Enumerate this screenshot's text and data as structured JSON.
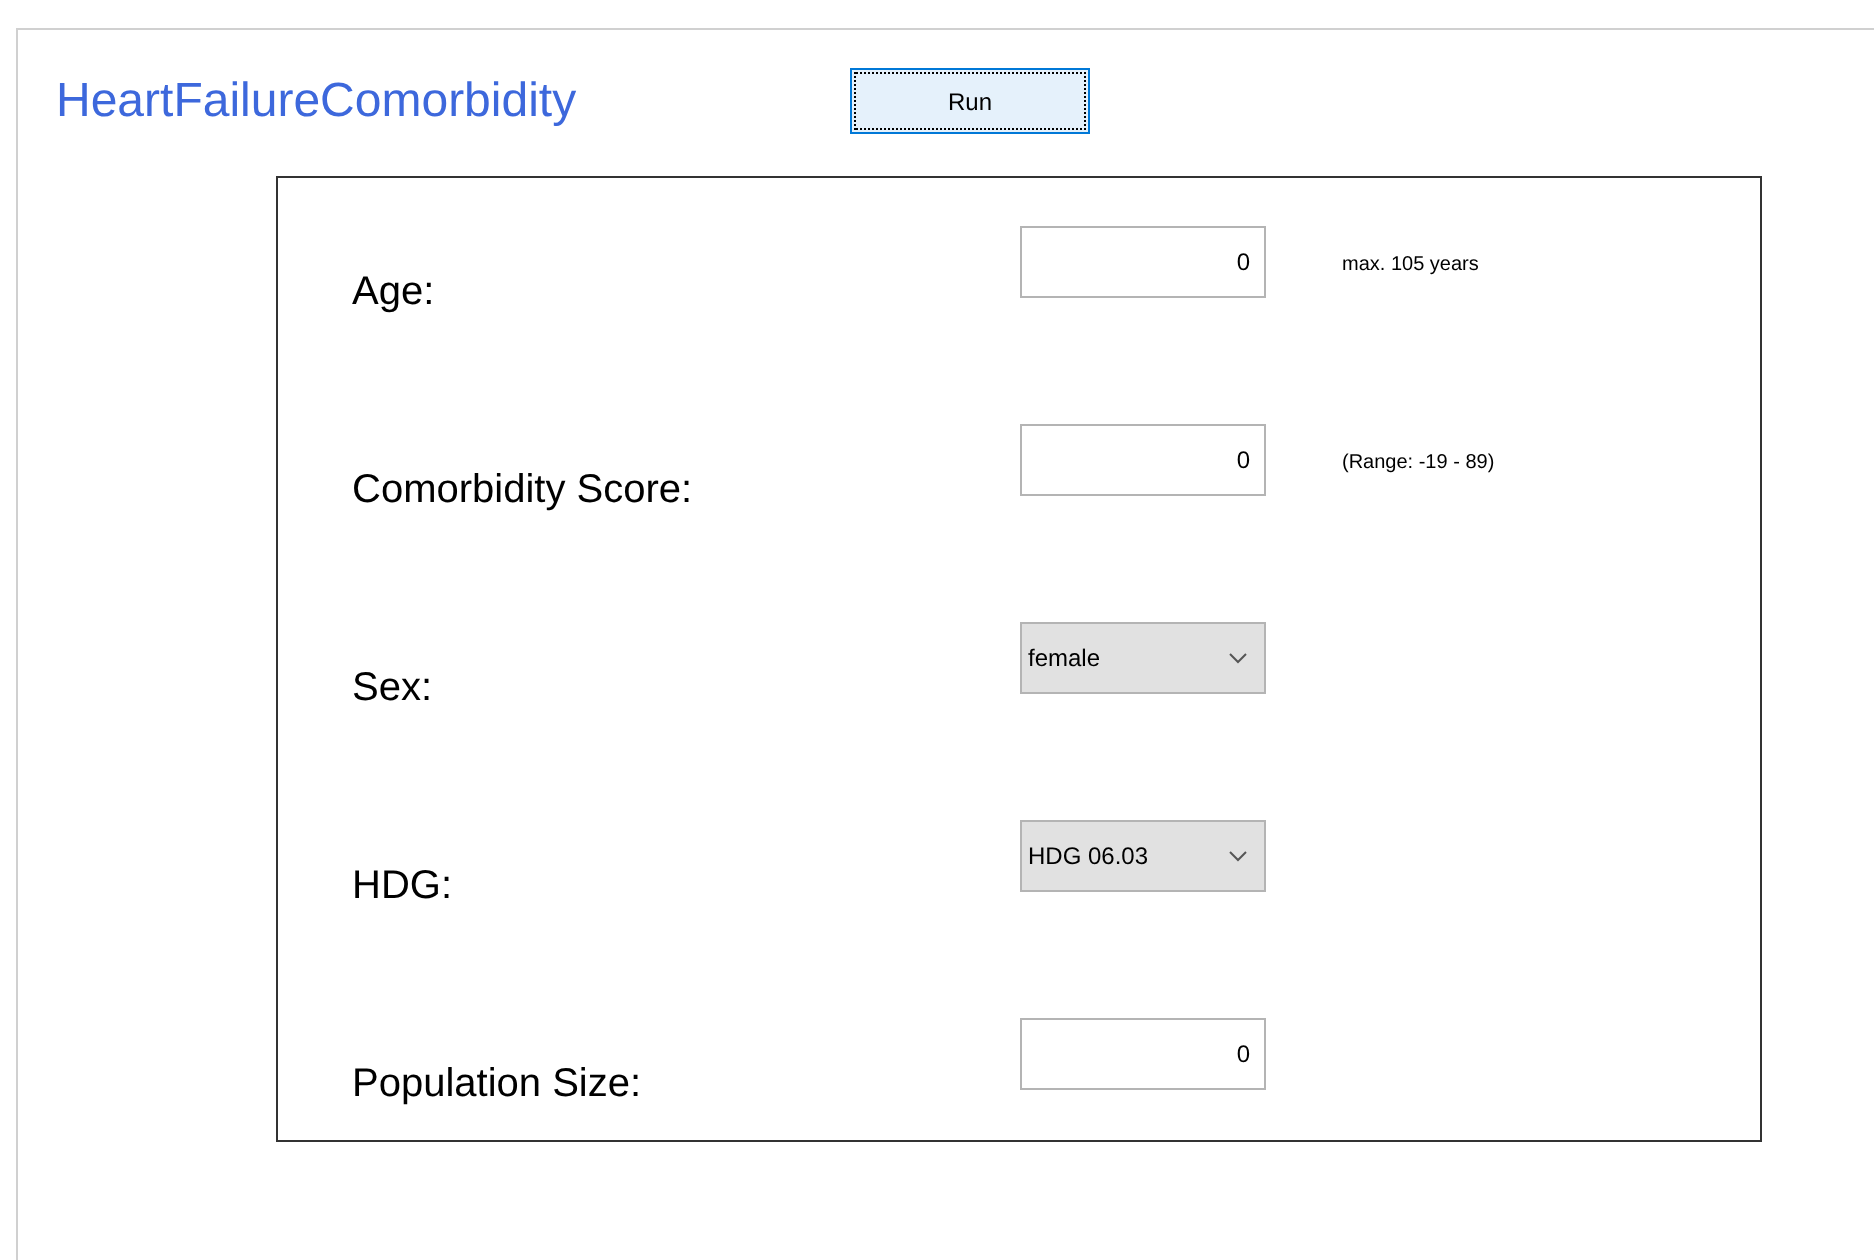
{
  "app": {
    "title": "HeartFailureComorbidity",
    "run_button": "Run"
  },
  "fields": [
    {
      "kind": "number",
      "label": "Age:",
      "value": "0",
      "hint": "max. 105 years"
    },
    {
      "kind": "number",
      "label": "Comorbidity Score:",
      "value": "0",
      "hint": "(Range: -19 - 89)"
    },
    {
      "kind": "select",
      "label": "Sex:",
      "value": "female"
    },
    {
      "kind": "select",
      "label": "HDG:",
      "value": "HDG 06.03"
    },
    {
      "kind": "number",
      "label": "Population Size:",
      "value": "0"
    }
  ]
}
